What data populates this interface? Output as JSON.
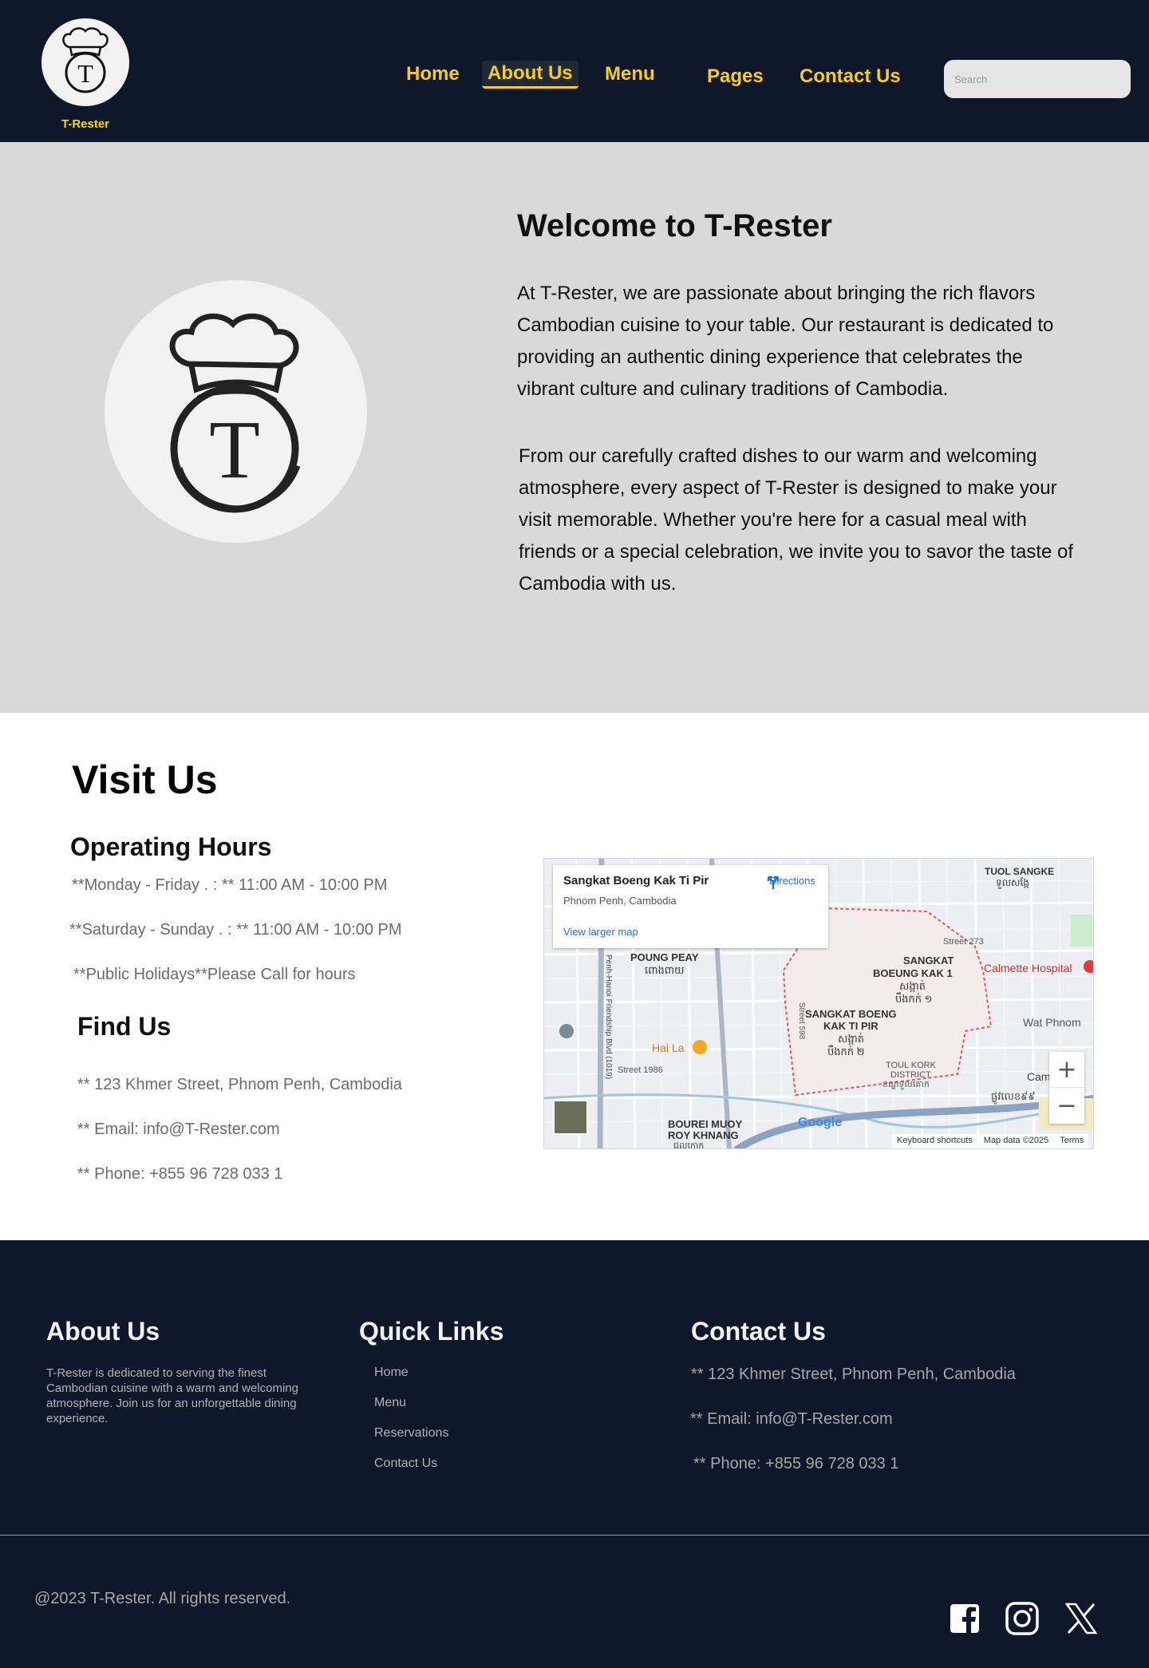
{
  "header": {
    "brand": "T-Rester",
    "nav": [
      {
        "label": "Home"
      },
      {
        "label": "About Us",
        "active": true
      },
      {
        "label": "Menu"
      },
      {
        "label": "Pages"
      },
      {
        "label": "Contact Us"
      }
    ],
    "search_placeholder": "Search"
  },
  "hero": {
    "title": "Welcome to T-Rester",
    "paragraph1": "At T-Rester, we are passionate about bringing the rich flavors Cambodian cuisine to your table. Our restaurant is dedicated to providing an authentic dining experience that celebrates the vibrant culture and culinary traditions of Cambodia.",
    "paragraph2": "From our carefully crafted dishes to our warm and welcoming atmosphere, every aspect of T-Rester is designed to make your visit memorable. Whether you're here for a casual meal with friends or a special celebration, we invite you to savor the taste of Cambodia with us."
  },
  "visit": {
    "title": "Visit Us",
    "hours_title": "Operating Hours",
    "hours": [
      " **Monday - Friday . : ** 11:00 AM - 10:00 PM",
      "**Saturday - Sunday . : ** 11:00 AM - 10:00 PM",
      " **Public Holidays**Please Call for hours"
    ],
    "find_title": "Find Us",
    "find": [
      " ** 123 Khmer Street, Phnom Penh, Cambodia",
      "** Email: info@T-Rester.com",
      " ** Phone: +855 96 728 033 1"
    ]
  },
  "map": {
    "place_title": "Sangkat Boeng Kak Ti Pir",
    "place_subtitle": "Phnom Penh, Cambodia",
    "view_larger": "View larger map",
    "directions": "Directions",
    "labels": [
      {
        "text": "TUOL SANGKE"
      },
      {
        "text": "ទួលសង្កែ"
      },
      {
        "text": "Street 273"
      },
      {
        "text": "SANGKAT"
      },
      {
        "text": "BOEUNG KAK 1"
      },
      {
        "text": "សង្កាត់"
      },
      {
        "text": "បឹងកក់ ១"
      },
      {
        "text": "Calmette Hospital"
      },
      {
        "text": "POUNG PEAY"
      },
      {
        "text": "ពោងពាយ"
      },
      {
        "text": "SANGKAT BOENG"
      },
      {
        "text": "KAK TI PIR"
      },
      {
        "text": "សង្កាត់"
      },
      {
        "text": "បឹងកក់ ២"
      },
      {
        "text": "Wat Phnom"
      },
      {
        "text": "Hai La"
      },
      {
        "text": "Street 1986"
      },
      {
        "text": "TOUL KORK"
      },
      {
        "text": "DISTRICT"
      },
      {
        "text": "ខណ្ឌទួលគោក"
      },
      {
        "text": "ផ្លូវលេខ៩៩"
      },
      {
        "text": "Cam"
      },
      {
        "text": "BOUREI MUOY"
      },
      {
        "text": "ROY KHNANG"
      },
      {
        "text": "Street 598"
      },
      {
        "text": "Penh-Hanoi Friendship Blvd (1019)"
      },
      {
        "text": "ជូលកោក"
      }
    ],
    "google": "Google",
    "attribution": [
      "Keyboard shortcuts",
      "Map data ©2025",
      "Terms"
    ],
    "zoom_in": "+",
    "zoom_out": "−"
  },
  "footer": {
    "about_title": "About Us",
    "about_text": "T-Rester is dedicated to serving the finest Cambodian cuisine with a warm and welcoming atmosphere. Join us for an unforgettable dining experience.",
    "links_title": "Quick Links",
    "links": [
      "Home",
      "Menu",
      "Reservations",
      "Contact Us"
    ],
    "contact_title": "Contact Us",
    "contact": [
      " ** 123 Khmer Street, Phnom Penh, Cambodia",
      "** Email: info@T-Rester.com",
      " ** Phone: +855 96 728 033 1"
    ],
    "copyright": "@2023 T-Rester. All rights reserved.",
    "social": [
      "facebook-icon",
      "instagram-icon",
      "x-icon"
    ]
  },
  "colors": {
    "navy": "#0f172a",
    "accent_yellow": "#facc15",
    "hero_bg": "#d9d9d9"
  }
}
